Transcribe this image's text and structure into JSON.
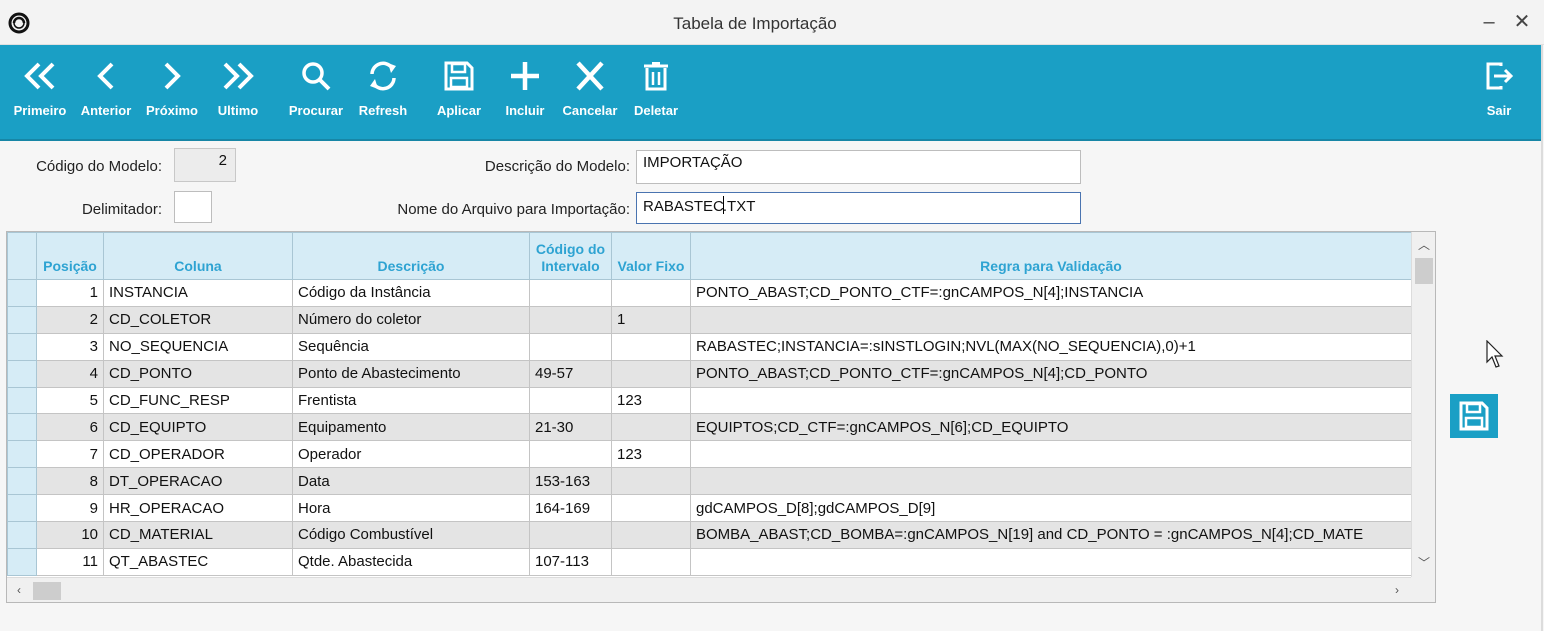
{
  "window": {
    "title": "Tabela de Importação",
    "minimize": "–",
    "close": "✕"
  },
  "toolbar": {
    "primeiro": "Primeiro",
    "anterior": "Anterior",
    "proximo": "Próximo",
    "ultimo": "Ultimo",
    "procurar": "Procurar",
    "refresh": "Refresh",
    "aplicar": "Aplicar",
    "incluir": "Incluir",
    "cancelar": "Cancelar",
    "deletar": "Deletar",
    "sair": "Sair"
  },
  "form": {
    "codigo_label": "Código do Modelo:",
    "codigo_value": "2",
    "delimitador_label": "Delimitador:",
    "delimitador_value": "",
    "descricao_label": "Descrição do Modelo:",
    "descricao_value": "IMPORTAÇÃO",
    "nome_label": "Nome do Arquivo para Importação:",
    "nome_value_before": "RABASTEC",
    "nome_value_after": ".TXT"
  },
  "grid": {
    "headers": {
      "posicao": "Posição",
      "coluna": "Coluna",
      "descricao": "Descrição",
      "codigo_line1": "Código do",
      "codigo_line2": "Intervalo",
      "valor_fixo": "Valor Fixo",
      "regra": "Regra para Validação"
    },
    "rows": [
      {
        "pos": "1",
        "coluna": "INSTANCIA",
        "descricao": "Código da Instância",
        "intervalo": "",
        "valor_fixo": "",
        "regra": "PONTO_ABAST;CD_PONTO_CTF=:gnCAMPOS_N[4];INSTANCIA"
      },
      {
        "pos": "2",
        "coluna": "CD_COLETOR",
        "descricao": "Número do coletor",
        "intervalo": "",
        "valor_fixo": "1",
        "regra": ""
      },
      {
        "pos": "3",
        "coluna": "NO_SEQUENCIA",
        "descricao": "Sequência",
        "intervalo": "",
        "valor_fixo": "",
        "regra": "RABASTEC;INSTANCIA=:sINSTLOGIN;NVL(MAX(NO_SEQUENCIA),0)+1"
      },
      {
        "pos": "4",
        "coluna": "CD_PONTO",
        "descricao": "Ponto de Abastecimento",
        "intervalo": "49-57",
        "valor_fixo": "",
        "regra": "PONTO_ABAST;CD_PONTO_CTF=:gnCAMPOS_N[4];CD_PONTO"
      },
      {
        "pos": "5",
        "coluna": "CD_FUNC_RESP",
        "descricao": "Frentista",
        "intervalo": "",
        "valor_fixo": "123",
        "regra": ""
      },
      {
        "pos": "6",
        "coluna": "CD_EQUIPTO",
        "descricao": "Equipamento",
        "intervalo": "21-30",
        "valor_fixo": "",
        "regra": "EQUIPTOS;CD_CTF=:gnCAMPOS_N[6];CD_EQUIPTO"
      },
      {
        "pos": "7",
        "coluna": "CD_OPERADOR",
        "descricao": "Operador",
        "intervalo": "",
        "valor_fixo": "123",
        "regra": ""
      },
      {
        "pos": "8",
        "coluna": "DT_OPERACAO",
        "descricao": "Data",
        "intervalo": "153-163",
        "valor_fixo": "",
        "regra": ""
      },
      {
        "pos": "9",
        "coluna": "HR_OPERACAO",
        "descricao": "Hora",
        "intervalo": "164-169",
        "valor_fixo": "",
        "regra": "gdCAMPOS_D[8];gdCAMPOS_D[9]"
      },
      {
        "pos": "10",
        "coluna": "CD_MATERIAL",
        "descricao": "Código Combustível",
        "intervalo": "",
        "valor_fixo": "",
        "regra": "BOMBA_ABAST;CD_BOMBA=:gnCAMPOS_N[19] and CD_PONTO = :gnCAMPOS_N[4];CD_MATE"
      },
      {
        "pos": "11",
        "coluna": "QT_ABASTEC",
        "descricao": "Qtde. Abastecida",
        "intervalo": "107-113",
        "valor_fixo": "",
        "regra": ""
      }
    ]
  },
  "colors": {
    "accent": "#1a9fc5",
    "header_bg": "#d6ecf6",
    "header_text": "#2ea3d2",
    "row_alt": "#e4e4e4"
  },
  "icons": {
    "primeiro": "double-chevron-left-icon",
    "anterior": "chevron-left-icon",
    "proximo": "chevron-right-icon",
    "ultimo": "double-chevron-right-icon",
    "procurar": "search-icon",
    "refresh": "refresh-icon",
    "aplicar": "save-icon",
    "incluir": "plus-icon",
    "cancelar": "x-icon",
    "deletar": "trash-icon",
    "sair": "exit-icon"
  }
}
